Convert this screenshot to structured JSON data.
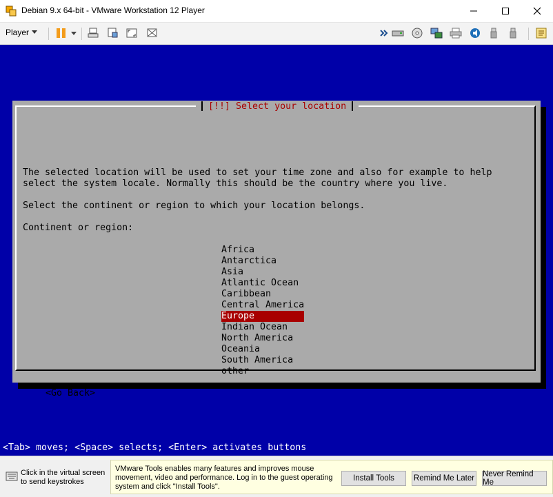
{
  "window": {
    "title": "Debian 9.x 64-bit - VMware Workstation 12 Player"
  },
  "toolbar": {
    "player_label": "Player",
    "icons": [
      "pause-icon",
      "send-ctrl-alt-del-icon",
      "fit-guest-icon",
      "full-screen-icon",
      "unity-icon",
      "hard-disk-icon",
      "cd-dvd-icon",
      "network-icon",
      "printer-icon",
      "sound-icon",
      "usb-icon",
      "usb-icon-2",
      "message-log-icon"
    ]
  },
  "installer": {
    "dialog_title": "[!!] Select your location",
    "description_line_1": "The selected location will be used to set your time zone and also for example to help",
    "description_line_2": "select the system locale. Normally this should be the country where you live.",
    "instruction": "Select the continent or region to which your location belongs.",
    "continent_label": "Continent or region:",
    "regions": [
      "Africa",
      "Antarctica",
      "Asia",
      "Atlantic Ocean",
      "Caribbean",
      "Central America",
      "Europe",
      "Indian Ocean",
      "North America",
      "Oceania",
      "South America",
      "other"
    ],
    "selected_region": "Europe",
    "go_back_label": "<Go Back>",
    "status_line": "<Tab> moves; <Space> selects; <Enter> activates buttons"
  },
  "bottom_bar": {
    "click_hint": "Click in the virtual screen to send keystrokes",
    "tools_message": "VMware Tools enables many features and improves mouse movement, video and performance. Log in to the guest operating system and click \"Install Tools\".",
    "install_tools_label": "Install Tools",
    "remind_later_label": "Remind Me Later",
    "never_remind_label": "Never Remind Me"
  },
  "colors": {
    "vm_background": "#0000a8",
    "dialog_background": "#aaaaaa",
    "selection_red": "#a80000",
    "pause_orange": "#f39c1b"
  }
}
